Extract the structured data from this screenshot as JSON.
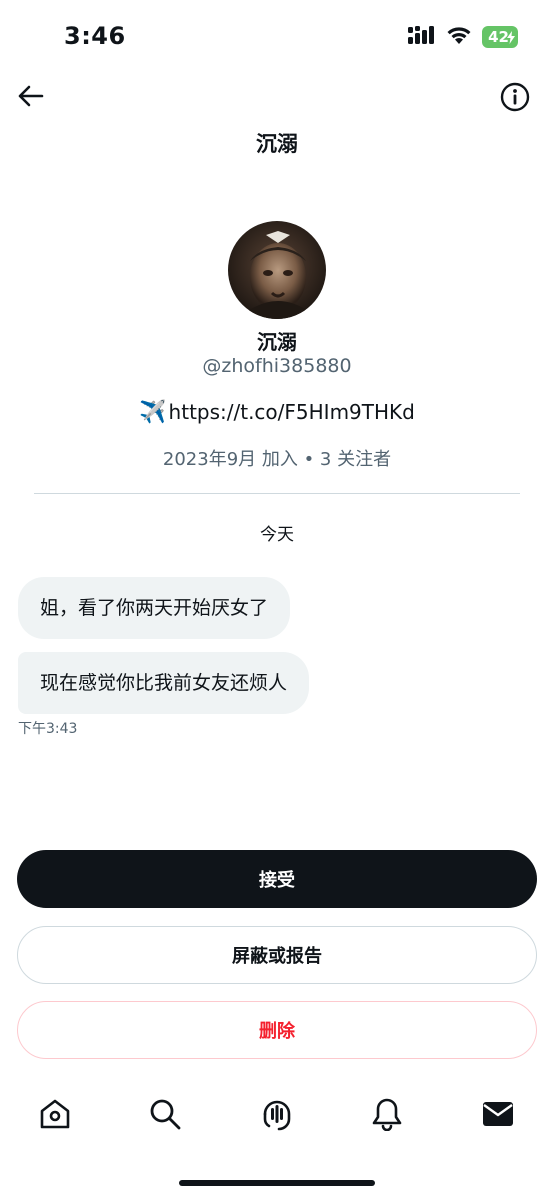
{
  "status_bar": {
    "time": "3:46",
    "battery": "42",
    "icons": [
      "cellular-signal-icon",
      "wifi-icon",
      "battery-charging-icon"
    ],
    "battery_color": "#65c466"
  },
  "header": {
    "title": "沉溺",
    "back_icon": "back-arrow-icon",
    "info_icon": "info-icon"
  },
  "profile": {
    "name": "沉溺",
    "handle": "@zhofhi385880",
    "bio_emoji": "✈️",
    "bio_link": "https://t.co/F5HIm9THKd",
    "meta": "2023年9月 加入 • 3 关注者"
  },
  "conversation": {
    "day_label": "今天",
    "messages": [
      {
        "text": "姐，看了你两天开始厌女了"
      },
      {
        "text": "现在感觉你比我前女友还烦人"
      }
    ],
    "time": "下午3:43"
  },
  "actions": {
    "accept": "接受",
    "block_report": "屏蔽或报告",
    "delete": "删除"
  },
  "bottom_nav": {
    "items": [
      "home-icon",
      "search-icon",
      "spaces-icon",
      "notifications-icon",
      "messages-icon"
    ]
  },
  "colors": {
    "text_primary": "#0f1419",
    "text_secondary": "#536471",
    "bubble_bg": "#eff3f4",
    "danger": "#f4212e",
    "accept_bg": "#0f1419"
  }
}
